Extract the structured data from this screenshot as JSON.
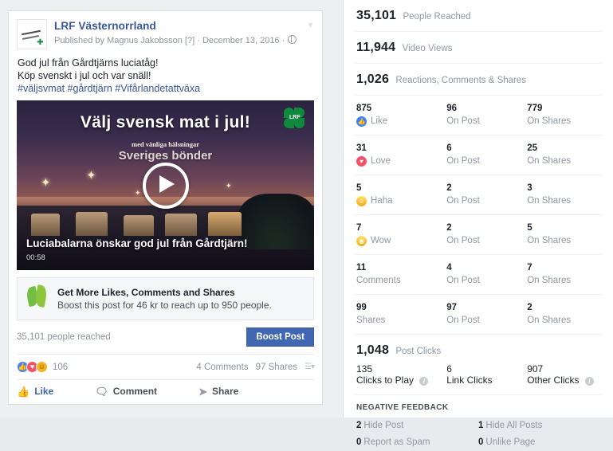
{
  "post": {
    "page_name": "LRF Västernorrland",
    "meta_published": "Published by",
    "meta_author": "Magnus Jakobsson",
    "meta_author_suffix": "[?]",
    "meta_sep1": "·",
    "meta_date": "December 13, 2016",
    "meta_sep2": "·",
    "menu_icon": "chevron-down-icon",
    "body_line1": "God jul från Gårdtjärns luciatåg!",
    "body_line2": "Köp svenskt i jul och var snäll!",
    "hashtags": "#väljsvmat #gårdtjärn #Vifårlandetattväxa",
    "video": {
      "headline": "Välj svensk mat i jul!",
      "sub1": "med vänliga hälsningar",
      "sub2": "Sveriges bönder",
      "caption": "Luciabalarna önskar god jul från Gårdtjärn!",
      "duration": "00:58",
      "badge": "LRF",
      "play_icon": "play-icon"
    },
    "boost": {
      "title": "Get More Likes, Comments and Shares",
      "subtitle": "Boost this post for 46 kr to reach up to 950 people.",
      "leaf_icon": "leaf-icon",
      "reach_text": "35,101 people reached",
      "button_label": "Boost Post"
    },
    "footer": {
      "reaction_icons": [
        "like-icon",
        "love-icon",
        "haha-icon"
      ],
      "reaction_count": "106",
      "comments": "4 Comments",
      "shares": "97 Shares",
      "more_icon": "chart-caret-icon"
    },
    "actions": [
      {
        "label": "Like",
        "icon": "thumbs-up-icon",
        "glyph": "▲"
      },
      {
        "label": "Comment",
        "icon": "comment-icon",
        "glyph": "■"
      },
      {
        "label": "Share",
        "icon": "share-arrow-icon",
        "glyph": "➤"
      }
    ]
  },
  "insights": {
    "summary": [
      {
        "value": "35,101",
        "label": "People Reached"
      },
      {
        "value": "11,944",
        "label": "Video Views"
      },
      {
        "value": "1,026",
        "label": "Reactions, Comments & Shares"
      }
    ],
    "breakdown": [
      {
        "total": "875",
        "label": "Like",
        "icon": "like-icon",
        "glyph": "👍",
        "on_post": "96",
        "on_post_label": "On Post",
        "on_shares": "779",
        "on_shares_label": "On Shares"
      },
      {
        "total": "31",
        "label": "Love",
        "icon": "love-icon",
        "glyph": "♥",
        "on_post": "6",
        "on_post_label": "On Post",
        "on_shares": "25",
        "on_shares_label": "On Shares"
      },
      {
        "total": "5",
        "label": "Haha",
        "icon": "haha-icon",
        "glyph": "◑",
        "on_post": "2",
        "on_post_label": "On Post",
        "on_shares": "3",
        "on_shares_label": "On Shares"
      },
      {
        "total": "7",
        "label": "Wow",
        "icon": "wow-icon",
        "glyph": "○",
        "on_post": "2",
        "on_post_label": "On Post",
        "on_shares": "5",
        "on_shares_label": "On Shares"
      },
      {
        "total": "11",
        "label": "Comments",
        "icon": "",
        "glyph": "",
        "on_post": "4",
        "on_post_label": "On Post",
        "on_shares": "7",
        "on_shares_label": "On Shares"
      },
      {
        "total": "99",
        "label": "Shares",
        "icon": "",
        "glyph": "",
        "on_post": "97",
        "on_post_label": "On Post",
        "on_shares": "2",
        "on_shares_label": "On Shares"
      }
    ],
    "post_clicks": {
      "value": "1,048",
      "label": "Post Clicks",
      "items": [
        {
          "value": "135",
          "label": "Clicks to Play",
          "info": true
        },
        {
          "value": "6",
          "label": "Link Clicks",
          "info": false
        },
        {
          "value": "907",
          "label": "Other Clicks",
          "info": true
        }
      ]
    },
    "negative_feedback": {
      "title": "NEGATIVE FEEDBACK",
      "items": [
        {
          "value": "2",
          "label": "Hide Post"
        },
        {
          "value": "1",
          "label": "Hide All Posts"
        },
        {
          "value": "0",
          "label": "Report as Spam"
        },
        {
          "value": "0",
          "label": "Unlike Page"
        }
      ]
    }
  },
  "colors": {
    "brand_blue": "#4267b2",
    "link_blue": "#365899",
    "like_blue": "#4080ff",
    "love_red": "#f25268",
    "haha_yellow": "#f7b125",
    "muted_gray": "#9197a3",
    "leaf_green": "#72bf44"
  }
}
